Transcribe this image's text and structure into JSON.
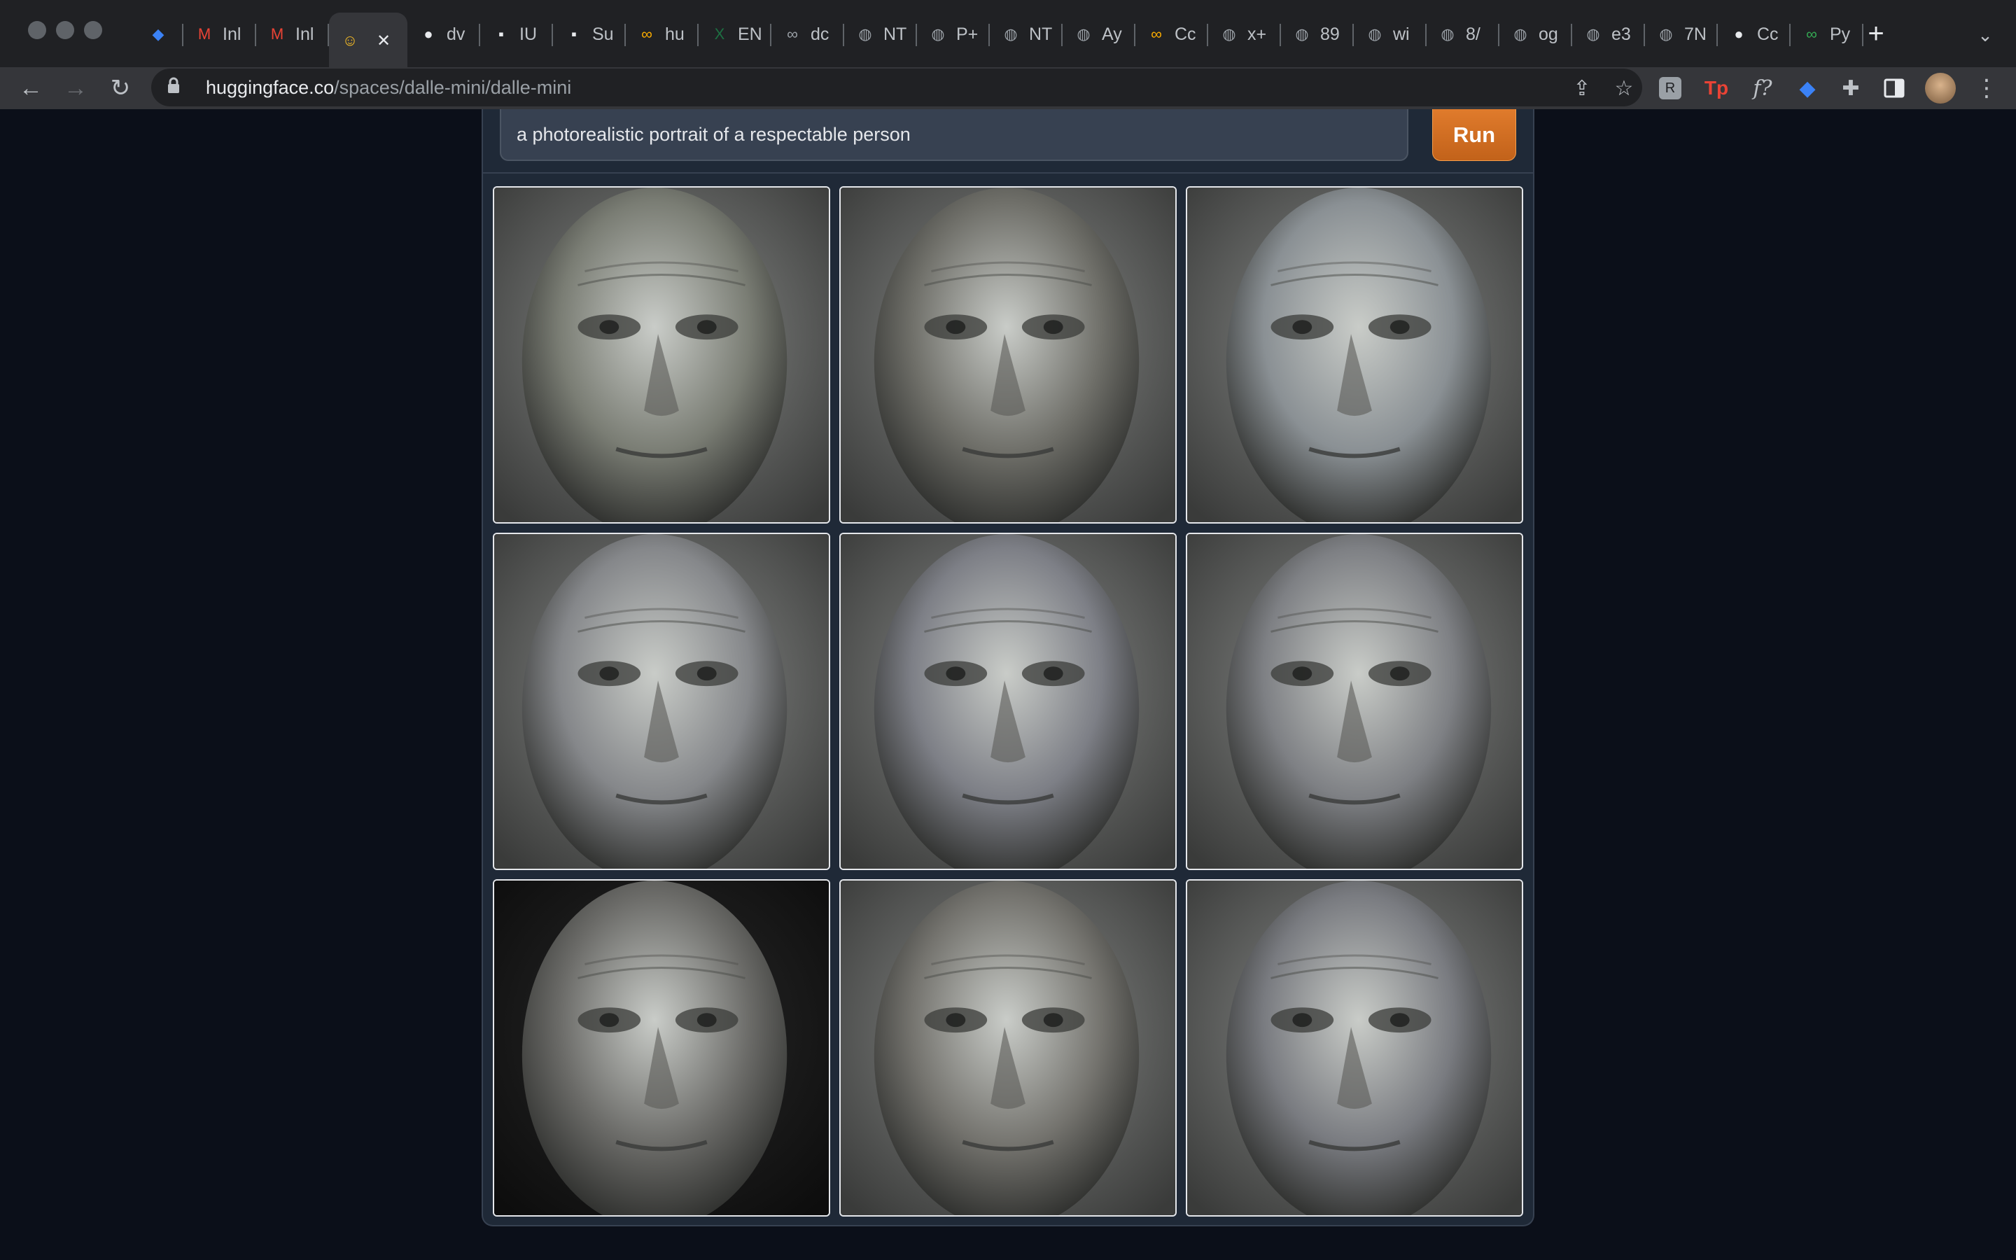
{
  "browser": {
    "tabs": [
      {
        "label": "",
        "icon": "gem-icon",
        "color": "#3b82f6"
      },
      {
        "label": "Inl",
        "icon": "gmail-icon",
        "color": "#ea4335"
      },
      {
        "label": "Inl",
        "icon": "gmail-icon",
        "color": "#ea4335"
      },
      {
        "label": "",
        "icon": "huggingface-icon",
        "color": "#fbbf24",
        "active": true
      },
      {
        "label": "dv",
        "icon": "github-icon",
        "color": "#e8eaed"
      },
      {
        "label": "IU",
        "icon": "app-icon",
        "color": "#e8eaed"
      },
      {
        "label": "Su",
        "icon": "app-icon",
        "color": "#e8eaed"
      },
      {
        "label": "hu",
        "icon": "colab-icon",
        "color": "#f9ab00"
      },
      {
        "label": "EN",
        "icon": "excel-icon",
        "color": "#1d6f42"
      },
      {
        "label": "dc",
        "icon": "link-icon",
        "color": "#9aa0a6"
      },
      {
        "label": "NT",
        "icon": "globe-icon",
        "color": "#9aa0a6"
      },
      {
        "label": "P+",
        "icon": "globe-icon",
        "color": "#9aa0a6"
      },
      {
        "label": "NT",
        "icon": "globe-icon",
        "color": "#9aa0a6"
      },
      {
        "label": "Ay",
        "icon": "globe-icon",
        "color": "#9aa0a6"
      },
      {
        "label": "Cc",
        "icon": "colab-icon",
        "color": "#f9ab00"
      },
      {
        "label": "x+",
        "icon": "globe-icon",
        "color": "#9aa0a6"
      },
      {
        "label": "89",
        "icon": "globe-icon",
        "color": "#9aa0a6"
      },
      {
        "label": "wi",
        "icon": "globe-icon",
        "color": "#9aa0a6"
      },
      {
        "label": "8/",
        "icon": "globe-icon",
        "color": "#9aa0a6"
      },
      {
        "label": "og",
        "icon": "globe-icon",
        "color": "#9aa0a6"
      },
      {
        "label": "e3",
        "icon": "globe-icon",
        "color": "#9aa0a6"
      },
      {
        "label": "7N",
        "icon": "globe-icon",
        "color": "#9aa0a6"
      },
      {
        "label": "Cc",
        "icon": "github-icon",
        "color": "#e8eaed"
      },
      {
        "label": "Py",
        "icon": "infinity-icon",
        "color": "#34a853"
      }
    ],
    "url_host": "huggingface.co",
    "url_path": "/spaces/dalle-mini/dalle-mini"
  },
  "app": {
    "prompt_value": "a photorealistic portrait  of a respectable person",
    "run_label": "Run",
    "accent_color": "#d97117",
    "images": [
      {
        "name": "generated-image-1",
        "tone": "#7a7d74"
      },
      {
        "name": "generated-image-2",
        "tone": "#6f6f69"
      },
      {
        "name": "generated-image-3",
        "tone": "#8a9094"
      },
      {
        "name": "generated-image-4",
        "tone": "#85878a"
      },
      {
        "name": "generated-image-5",
        "tone": "#7d7f86"
      },
      {
        "name": "generated-image-6",
        "tone": "#7e8084"
      },
      {
        "name": "generated-image-7",
        "tone": "#6b6b68"
      },
      {
        "name": "generated-image-8",
        "tone": "#74736e"
      },
      {
        "name": "generated-image-9",
        "tone": "#797b80"
      }
    ]
  }
}
